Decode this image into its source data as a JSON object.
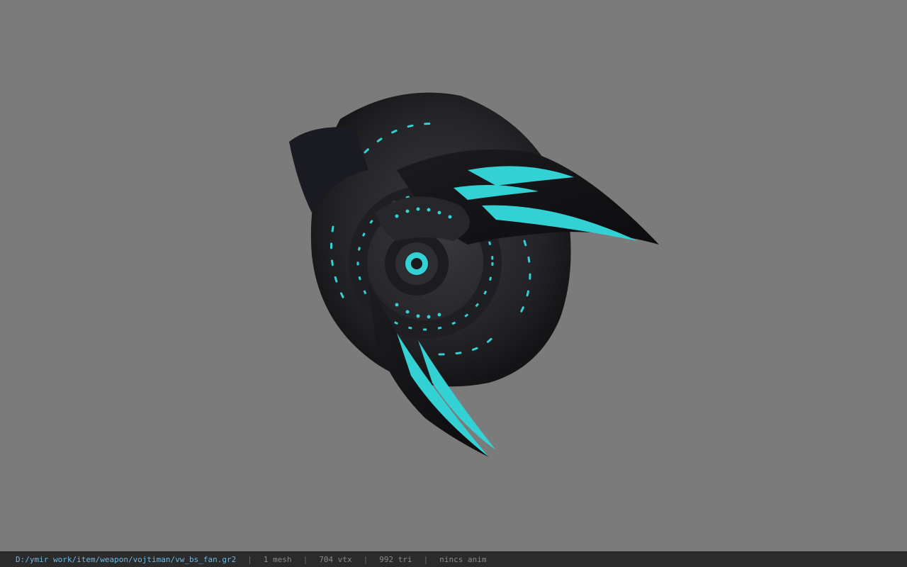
{
  "viewer": {
    "background_color": "#7b7b7b",
    "model": {
      "icon": "fan-weapon-model",
      "colors": {
        "body": "#2a2a2e",
        "body_dark": "#151518",
        "accent": "#33d1d4"
      }
    }
  },
  "status": {
    "file_path": "D:/ymir work/item/weapon/vojtiman/vw_bs_fan.gr2",
    "mesh": "1 mesh",
    "vertices": "704 vtx",
    "triangles": "992 tri",
    "anim": "nincs anim",
    "separator": "|"
  }
}
